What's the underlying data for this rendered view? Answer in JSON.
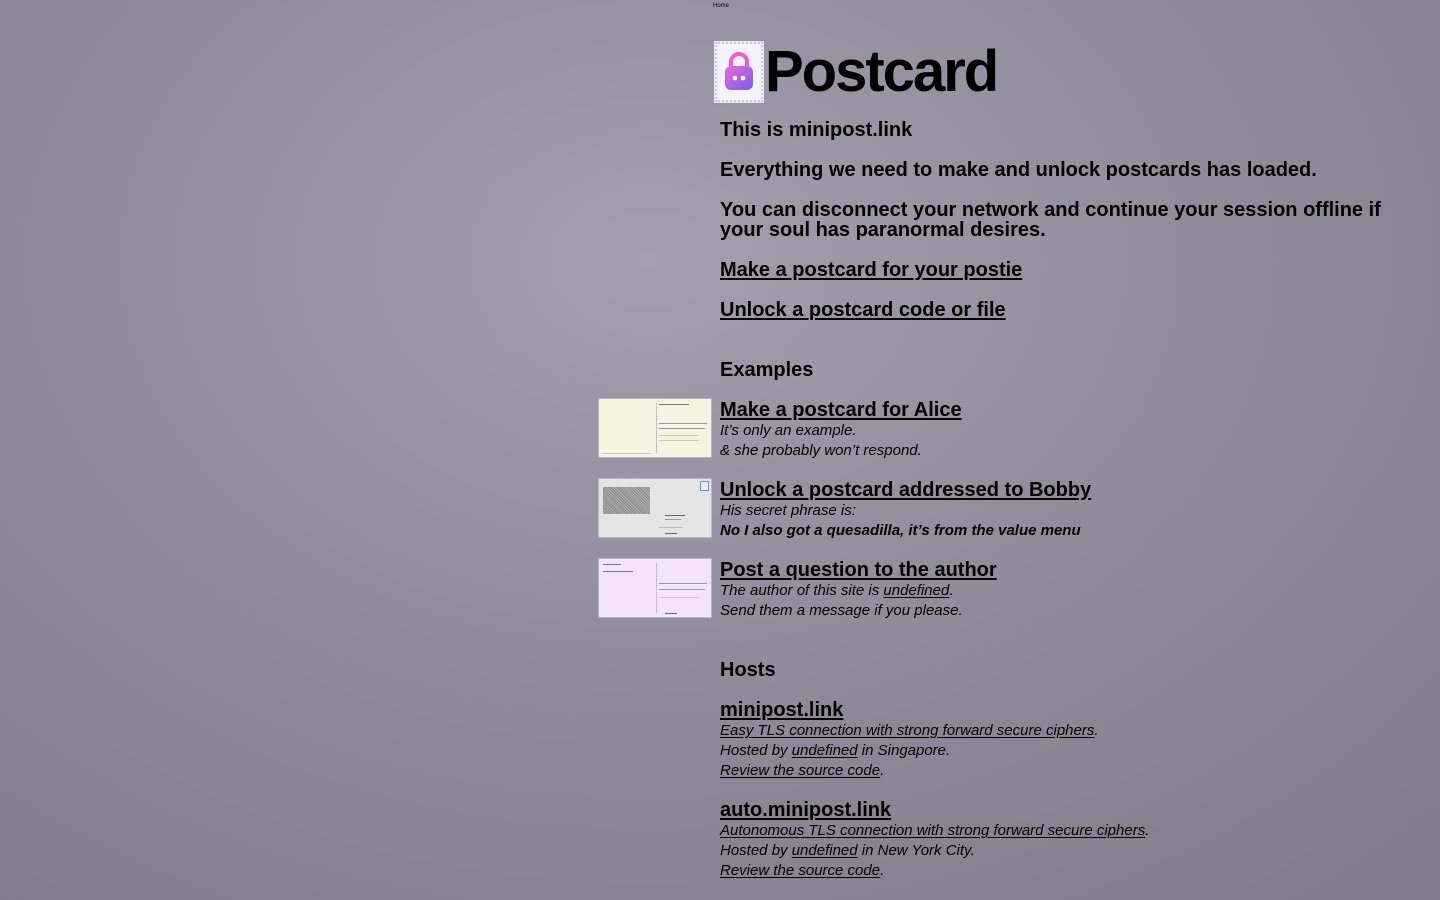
{
  "nav": {
    "home": "Home"
  },
  "brand": {
    "title": "Postcard",
    "stamp_icon": "padlock-stamp-icon"
  },
  "intro": {
    "site": "This is minipost.link",
    "loaded": "Everything we need to make and unlock postcards has loaded.",
    "offline": "You can disconnect your network and continue your session offline if your soul has paranormal desires."
  },
  "actions": {
    "make": "Make a postcard for your postie",
    "unlock": "Unlock a postcard code or file"
  },
  "examples": {
    "heading": "Examples",
    "items": [
      {
        "title": "Make a postcard for Alice",
        "line1": "It’s only an example.",
        "line2": "& she probably won’t respond.",
        "thumb_color": "#f4f4e2"
      },
      {
        "title": "Unlock a postcard addressed to Bobby",
        "line1": "His secret phrase is:",
        "line2": "No I also got a quesadilla, it’s from the value menu",
        "thumb_color": "#e4e4e4"
      },
      {
        "title": "Post a question to the author",
        "line1_pre": "The author of this site is ",
        "line1_link": "undefined",
        "line1_post": ".",
        "line2": "Send them a message if you please.",
        "thumb_color": "#f3e5f7"
      }
    ]
  },
  "hosts": {
    "heading": "Hosts",
    "items": [
      {
        "name": "minipost.link",
        "tls": "Easy TLS connection with strong forward secure ciphers",
        "hosted_pre": "Hosted by ",
        "hosted_link": "undefined",
        "hosted_post": " in Singapore.",
        "source": "Review the source code"
      },
      {
        "name": "auto.minipost.link",
        "tls": "Autonomous TLS connection with strong forward secure ciphers",
        "hosted_pre": "Hosted by ",
        "hosted_link": "undefined",
        "hosted_post": " in New York City.",
        "source": "Review the source code"
      }
    ]
  }
}
